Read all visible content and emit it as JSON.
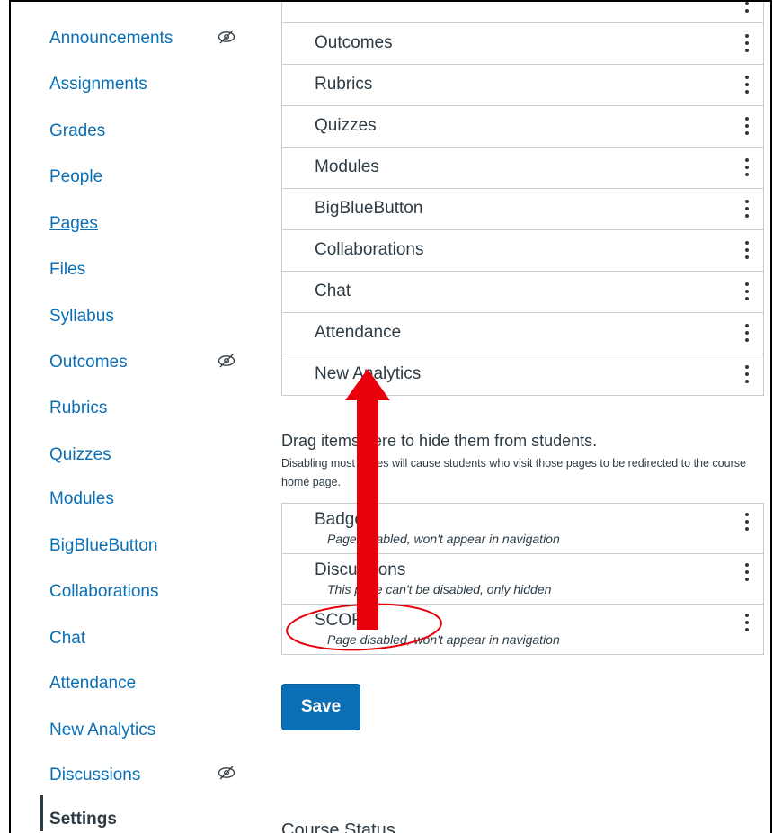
{
  "sidebar": {
    "items": [
      {
        "label": "Announcements",
        "hidden": true
      },
      {
        "label": "Assignments"
      },
      {
        "label": "Grades"
      },
      {
        "label": "People"
      },
      {
        "label": "Pages"
      },
      {
        "label": "Files"
      },
      {
        "label": "Syllabus"
      },
      {
        "label": "Outcomes",
        "hidden": true
      },
      {
        "label": "Rubrics"
      },
      {
        "label": "Quizzes"
      },
      {
        "label": "Modules"
      },
      {
        "label": "BigBlueButton"
      },
      {
        "label": "Collaborations"
      },
      {
        "label": "Chat"
      },
      {
        "label": "Attendance"
      },
      {
        "label": "New Analytics"
      },
      {
        "label": "Discussions",
        "hidden": true
      },
      {
        "label": "Settings",
        "current": true
      }
    ]
  },
  "enabled_items": [
    {
      "label": "Outcomes"
    },
    {
      "label": "Rubrics"
    },
    {
      "label": "Quizzes"
    },
    {
      "label": "Modules"
    },
    {
      "label": "BigBlueButton"
    },
    {
      "label": "Collaborations"
    },
    {
      "label": "Chat"
    },
    {
      "label": "Attendance"
    },
    {
      "label": "New Analytics"
    }
  ],
  "disabled_section": {
    "title": "Drag items here to hide them from students.",
    "help": "Disabling most pages will cause students who visit those pages to be redirected to the course home page.",
    "items": [
      {
        "label": "Badges",
        "note": "Page disabled, won't appear in navigation"
      },
      {
        "label": "Discussions",
        "note": "This page can't be disabled, only hidden"
      },
      {
        "label": "SCORM",
        "note": "Page disabled, won't appear in navigation"
      }
    ]
  },
  "save_label": "Save",
  "course_status_heading": "Course Status",
  "colors": {
    "link": "#0b6fb5",
    "text": "#2d3b45",
    "border": "#c7cdd1",
    "save_button": "#0b6fb5",
    "annotation": "#e8000d"
  },
  "icons": {
    "hidden": "eye-slash-icon",
    "menu": "kebab-menu-icon"
  }
}
